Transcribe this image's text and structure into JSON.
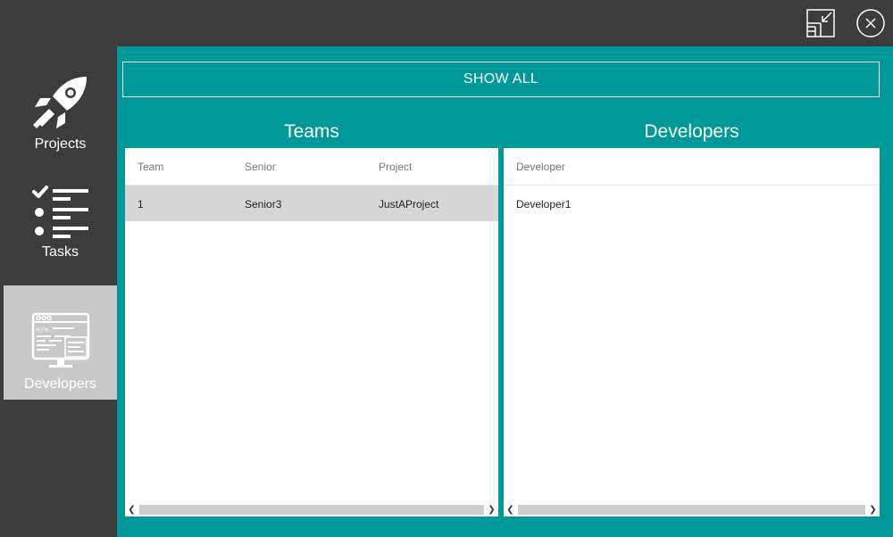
{
  "window": {
    "restore_icon": "restore-down-icon",
    "close_icon": "close-circle-icon"
  },
  "sidebar": {
    "items": [
      {
        "label": "Projects",
        "icon": "rocket-icon",
        "selected": false
      },
      {
        "label": "Tasks",
        "icon": "checklist-icon",
        "selected": false
      },
      {
        "label": "Developers",
        "icon": "code-window-icon",
        "selected": true
      }
    ]
  },
  "main": {
    "show_all_label": "SHOW ALL",
    "teams": {
      "title": "Teams",
      "columns": [
        "Team",
        "Senior",
        "Project"
      ],
      "rows": [
        {
          "team": "1",
          "senior": "Senior3",
          "project": "JustAProject",
          "selected": true
        }
      ]
    },
    "developers": {
      "title": "Developers",
      "columns": [
        "Developer"
      ],
      "rows": [
        {
          "developer": "Developer1"
        }
      ]
    }
  },
  "colors": {
    "accent": "#009999",
    "chrome": "#3c3c3c",
    "selected_nav": "#c8c8c8",
    "selected_row": "#d6d6d6"
  }
}
